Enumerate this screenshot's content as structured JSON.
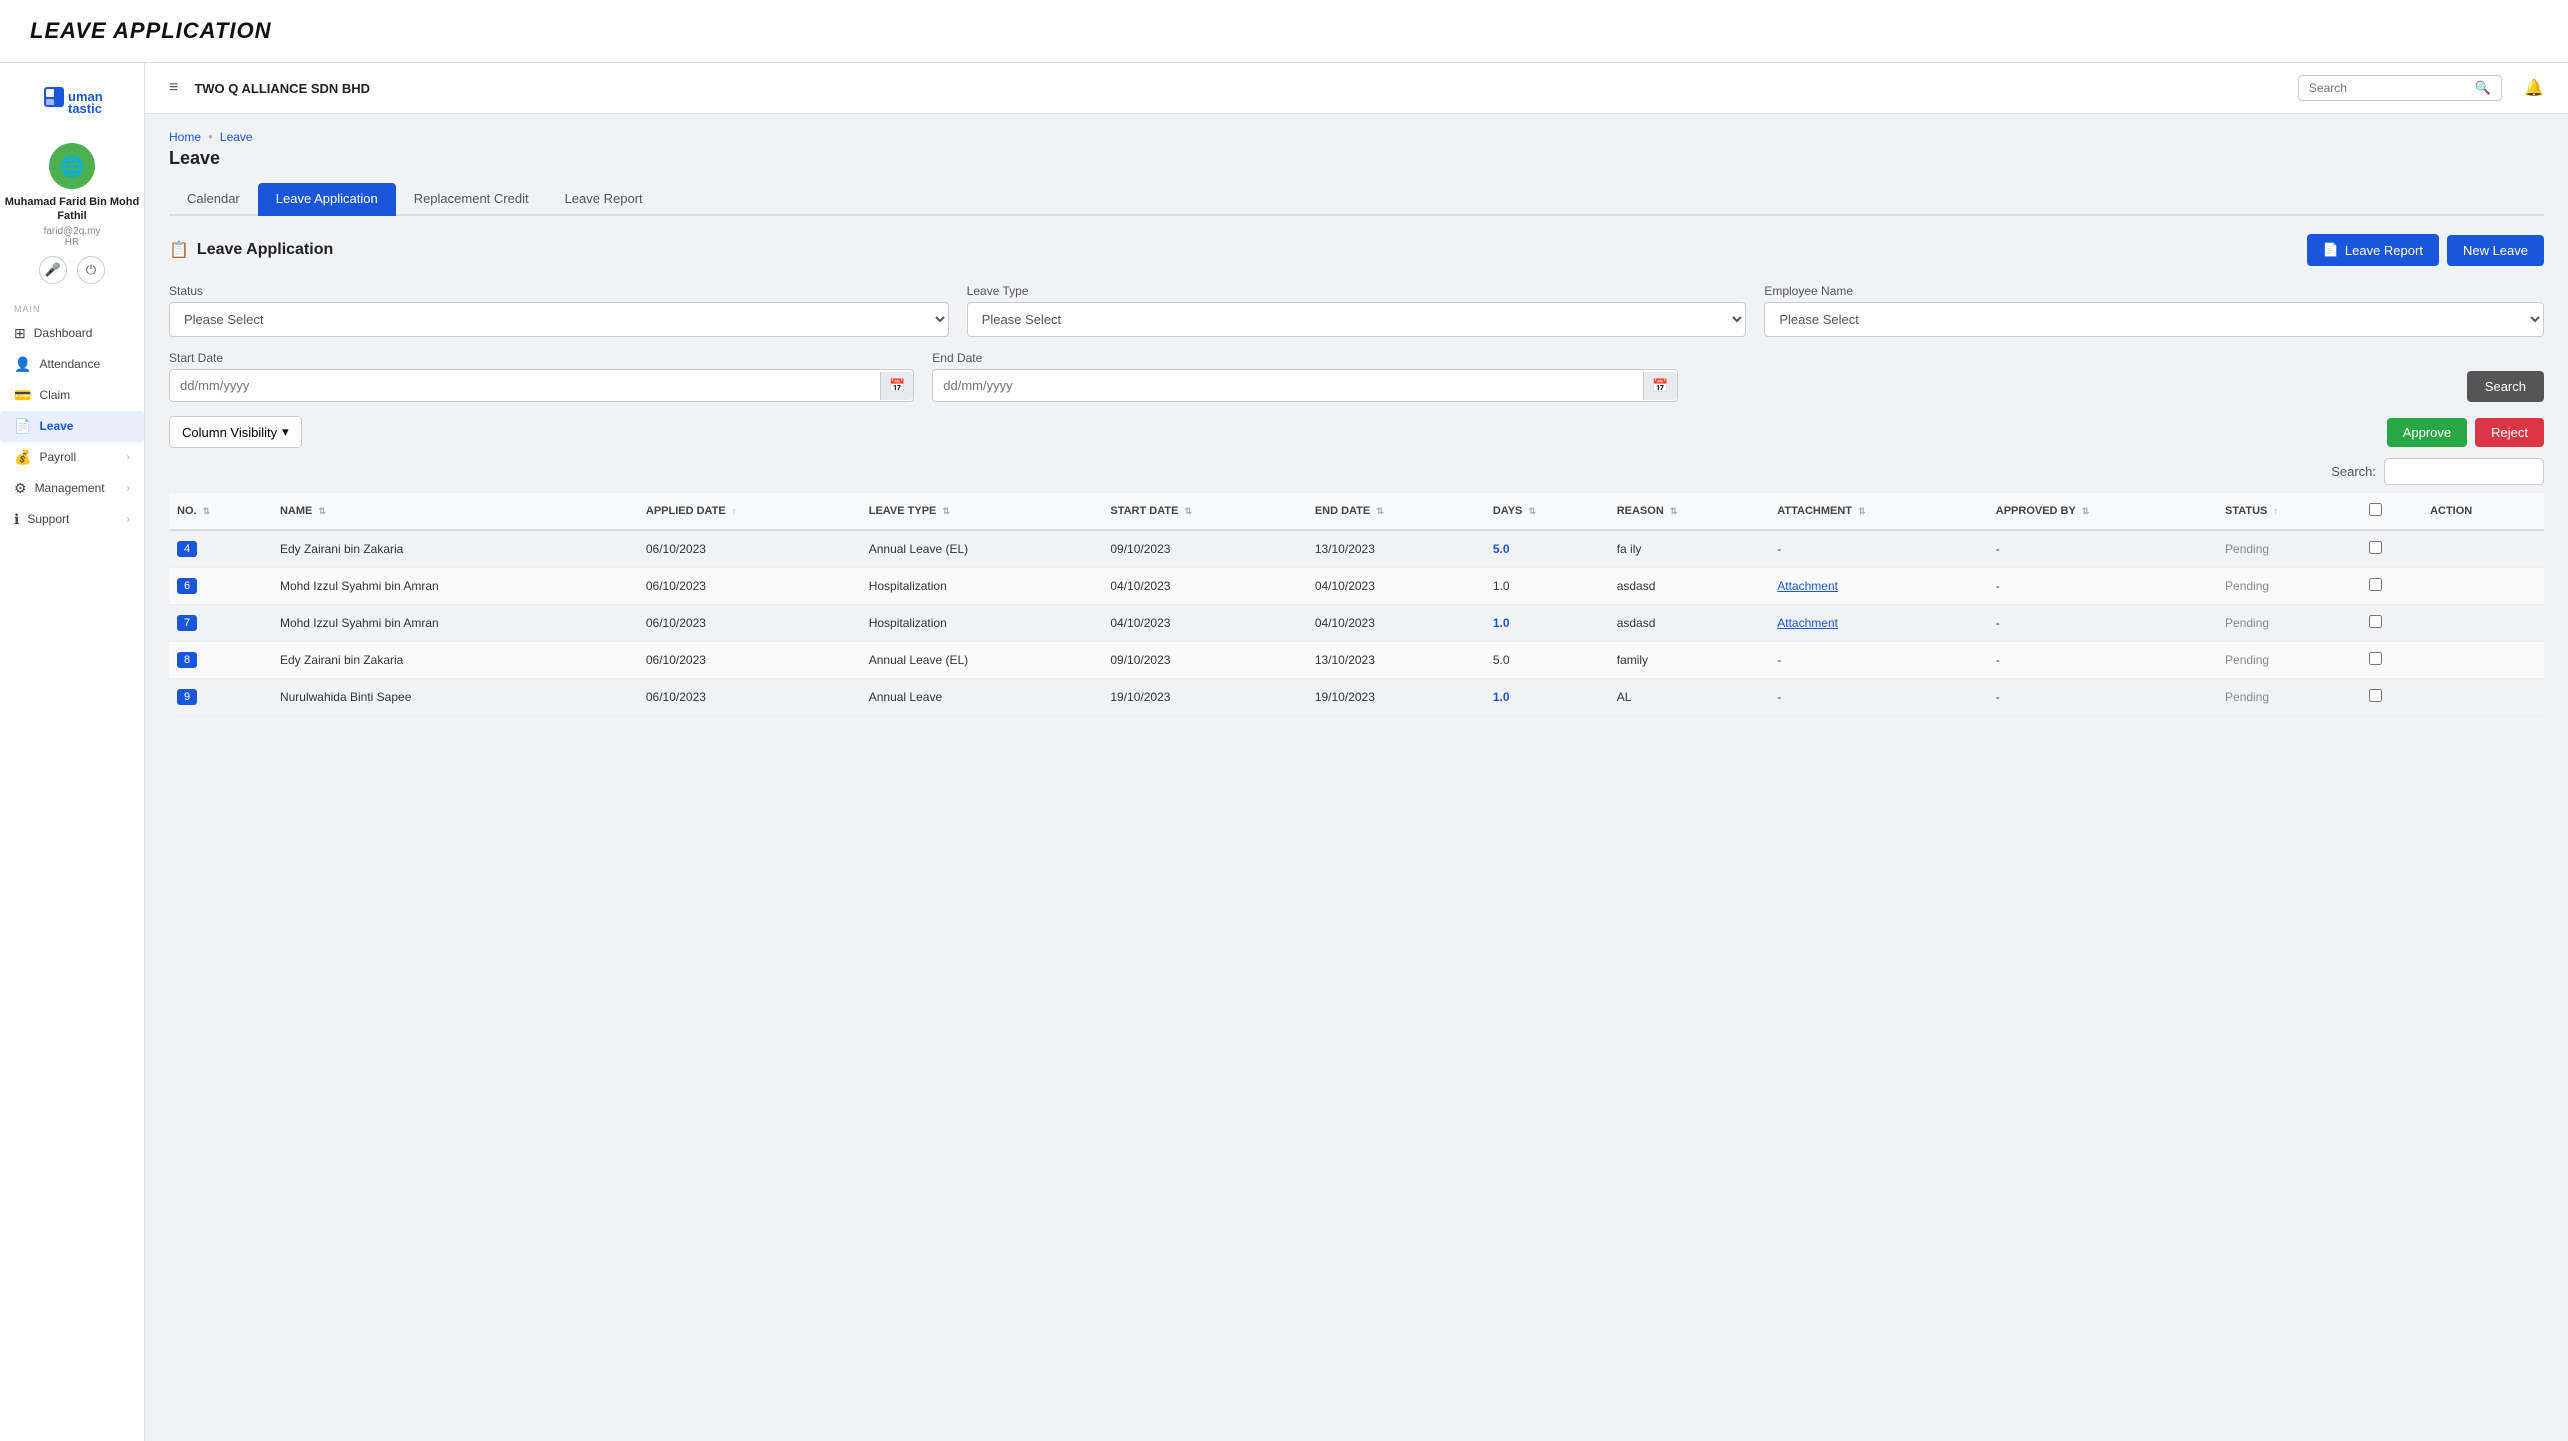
{
  "page": {
    "title": "LEAVE APPLICATION"
  },
  "topbar": {
    "menu_icon": "≡",
    "company": "TWO Q ALLIANCE SDN BHD",
    "search_placeholder": "Search",
    "notif_icon": "🔔"
  },
  "breadcrumb": {
    "home": "Home",
    "separator": "•",
    "current": "Leave"
  },
  "section_heading": "Leave",
  "tabs": [
    {
      "label": "Calendar",
      "active": false
    },
    {
      "label": "Leave Application",
      "active": true
    },
    {
      "label": "Replacement Credit",
      "active": false
    },
    {
      "label": "Leave Report",
      "active": false
    }
  ],
  "leave_application": {
    "section_title": "Leave Application",
    "section_icon": "📋",
    "buttons": {
      "leave_report": "Leave Report",
      "new_leave": "New Leave"
    },
    "filters": {
      "status_label": "Status",
      "status_placeholder": "Please Select",
      "leave_type_label": "Leave Type",
      "leave_type_placeholder": "Please Select",
      "employee_name_label": "Employee Name",
      "employee_name_placeholder": "Please Select",
      "start_date_label": "Start Date",
      "start_date_placeholder": "dd/mm/yyyy",
      "end_date_label": "End Date",
      "end_date_placeholder": "dd/mm/yyyy",
      "search_btn": "Search"
    },
    "table": {
      "column_visibility_btn": "Column Visibility",
      "dropdown_icon": "▾",
      "approve_btn": "Approve",
      "reject_btn": "Reject",
      "search_label": "Search:",
      "columns": [
        "NO.",
        "NAME",
        "APPLIED DATE",
        "LEAVE TYPE",
        "START DATE",
        "END DATE",
        "DAYS",
        "REASON",
        "ATTACHMENT",
        "APPROVED BY",
        "STATUS",
        "",
        "ACTION"
      ],
      "rows": [
        {
          "no": "4",
          "name": "Edy Zairani bin Zakaria",
          "applied_date": "06/10/2023",
          "leave_type": "Annual Leave (EL)",
          "start_date": "09/10/2023",
          "end_date": "13/10/2023",
          "days": "5.0",
          "days_highlight": true,
          "reason": "fa ily",
          "attachment": "-",
          "attachment_link": false,
          "approved_by": "-",
          "status": "Pending"
        },
        {
          "no": "6",
          "name": "Mohd Izzul Syahmi bin Amran",
          "applied_date": "06/10/2023",
          "leave_type": "Hospitalization",
          "start_date": "04/10/2023",
          "end_date": "04/10/2023",
          "days": "1.0",
          "days_highlight": false,
          "reason": "asdasd",
          "attachment": "Attachment",
          "attachment_link": true,
          "approved_by": "-",
          "status": "Pending"
        },
        {
          "no": "7",
          "name": "Mohd Izzul Syahmi bin Amran",
          "applied_date": "06/10/2023",
          "leave_type": "Hospitalization",
          "start_date": "04/10/2023",
          "end_date": "04/10/2023",
          "days": "1.0",
          "days_highlight": true,
          "reason": "asdasd",
          "attachment": "Attachment",
          "attachment_link": true,
          "approved_by": "-",
          "status": "Pending"
        },
        {
          "no": "8",
          "name": "Edy Zairani bin Zakaria",
          "applied_date": "06/10/2023",
          "leave_type": "Annual Leave (EL)",
          "start_date": "09/10/2023",
          "end_date": "13/10/2023",
          "days": "5.0",
          "days_highlight": false,
          "reason": "family",
          "attachment": "-",
          "attachment_link": false,
          "approved_by": "-",
          "status": "Pending"
        },
        {
          "no": "9",
          "name": "Nurulwahida Binti Sapee",
          "applied_date": "06/10/2023",
          "leave_type": "Annual Leave",
          "start_date": "19/10/2023",
          "end_date": "19/10/2023",
          "days": "1.0",
          "days_highlight": true,
          "reason": "AL",
          "attachment": "-",
          "attachment_link": false,
          "approved_by": "-",
          "status": "Pending"
        }
      ]
    }
  },
  "sidebar": {
    "user_name": "Muhamad Farid Bin Mohd Fathil",
    "user_email": "farid@2q.my",
    "user_role": "HR",
    "section_label": "MAIN",
    "nav_items": [
      {
        "icon": "⊞",
        "label": "Dashboard",
        "active": false,
        "has_arrow": false
      },
      {
        "icon": "👤",
        "label": "Attendance",
        "active": false,
        "has_arrow": false
      },
      {
        "icon": "💳",
        "label": "Claim",
        "active": false,
        "has_arrow": false
      },
      {
        "icon": "📄",
        "label": "Leave",
        "active": true,
        "has_arrow": false
      },
      {
        "icon": "💰",
        "label": "Payroll",
        "active": false,
        "has_arrow": true
      },
      {
        "icon": "⚙",
        "label": "Management",
        "active": false,
        "has_arrow": true
      },
      {
        "icon": "ℹ",
        "label": "Support",
        "active": false,
        "has_arrow": true
      }
    ]
  },
  "colors": {
    "primary": "#1a56db",
    "success": "#28a745",
    "danger": "#dc3545",
    "sidebar_active_bg": "#e8f0fe",
    "sidebar_active_text": "#1a56db"
  }
}
